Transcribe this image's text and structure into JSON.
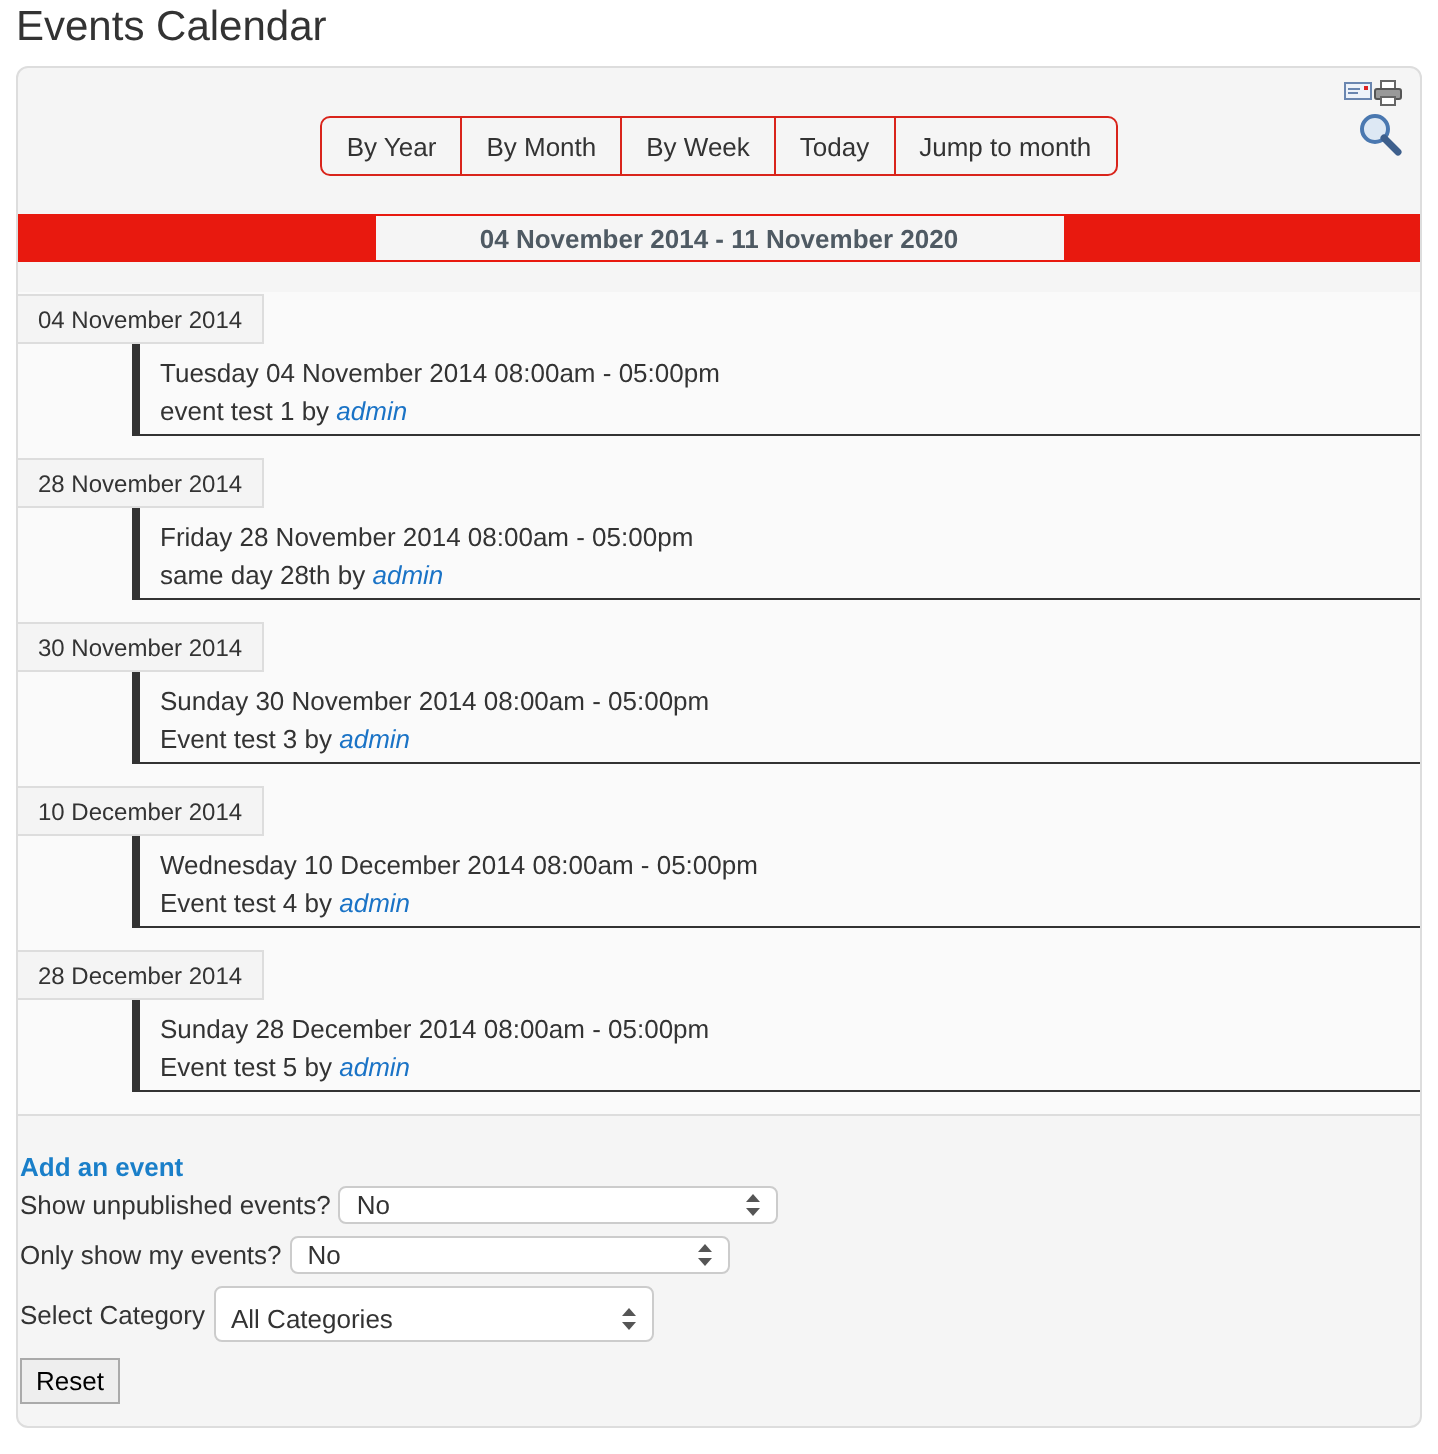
{
  "page_title": "Events Calendar",
  "nav_buttons": [
    "By Year",
    "By Month",
    "By Week",
    "Today",
    "Jump to month"
  ],
  "date_range": "04 November 2014 - 11 November 2020",
  "events": [
    {
      "date_heading": "04 November 2014",
      "when": "Tuesday 04 November 2014 08:00am - 05:00pm",
      "title": "event test 1",
      "by": "by",
      "author": "admin"
    },
    {
      "date_heading": "28 November 2014",
      "when": "Friday 28 November 2014 08:00am - 05:00pm",
      "title": "same day 28th",
      "by": "by",
      "author": "admin"
    },
    {
      "date_heading": "30 November 2014",
      "when": "Sunday 30 November 2014 08:00am - 05:00pm",
      "title": "Event test 3",
      "by": "by",
      "author": "admin"
    },
    {
      "date_heading": "10 December 2014",
      "when": "Wednesday 10 December 2014 08:00am - 05:00pm",
      "title": "Event test 4",
      "by": "by",
      "author": "admin"
    },
    {
      "date_heading": "28 December 2014",
      "when": "Sunday 28 December 2014 08:00am - 05:00pm",
      "title": "Event test 5",
      "by": "by",
      "author": "admin"
    }
  ],
  "add_event_link": "Add an event",
  "filters": [
    {
      "label": "Show unpublished events?",
      "value": "No"
    },
    {
      "label": "Only show my events?",
      "value": "No"
    },
    {
      "label": "Select Category",
      "value": "All Categories"
    }
  ],
  "reset_button": "Reset"
}
